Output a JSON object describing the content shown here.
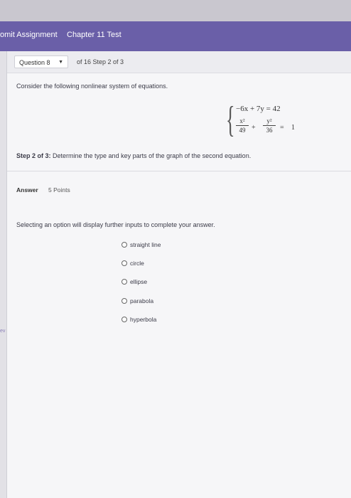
{
  "header": {
    "assignment_label": "omit Assignment",
    "test_title": "Chapter 11 Test"
  },
  "question_nav": {
    "selected": "Question 8",
    "info": "of 16 Step 2 of 3"
  },
  "problem": {
    "prompt": "Consider the following nonlinear system of equations.",
    "equation1": "−6x + 7y = 42",
    "equation2": {
      "term1_num": "x²",
      "term1_den": "49",
      "plus": "+",
      "term2_num": "y²",
      "term2_den": "36",
      "equals": "=",
      "rhs": "1"
    },
    "step_label": "Step 2 of 3:",
    "step_text": " Determine the type and key parts of the graph of the second equation."
  },
  "answer": {
    "label": "Answer",
    "points": "5 Points",
    "instruction": "Selecting an option will display further inputs to complete your answer.",
    "options": [
      "straight line",
      "circle",
      "ellipse",
      "parabola",
      "hyperbola"
    ]
  },
  "side": {
    "fragment": "ev"
  }
}
